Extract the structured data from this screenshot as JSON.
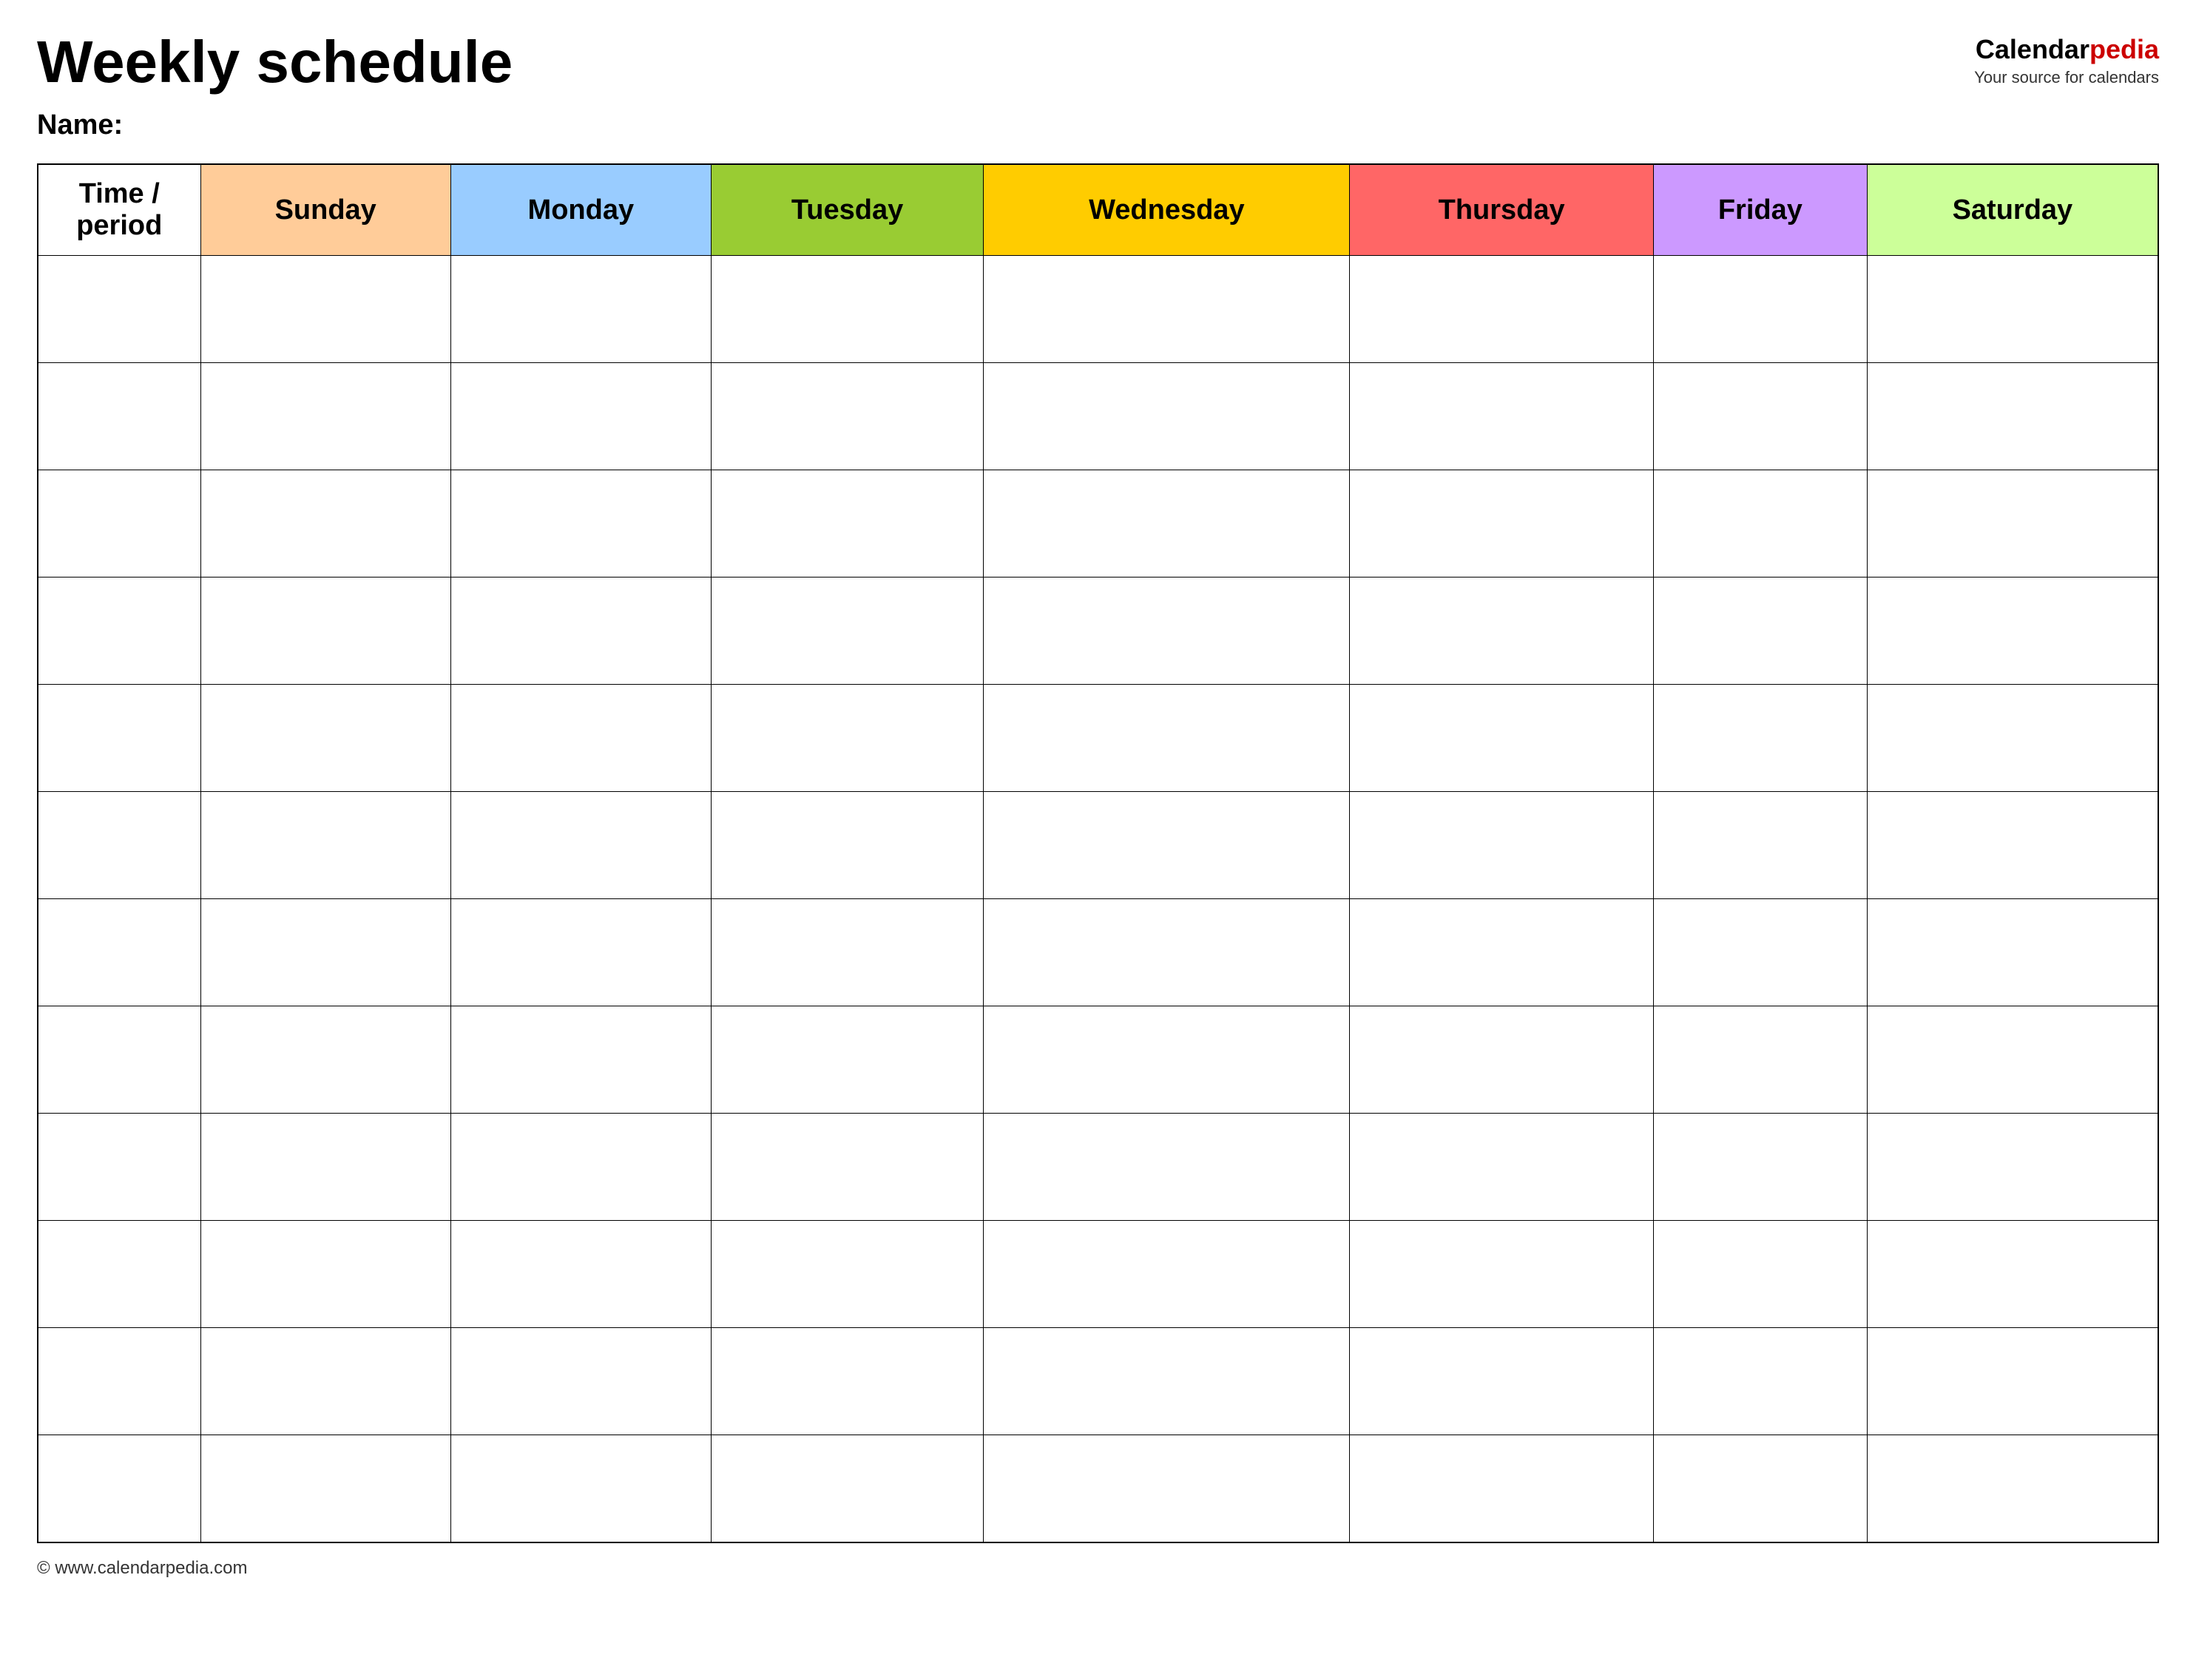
{
  "header": {
    "title": "Weekly schedule",
    "name_label": "Name:",
    "logo": {
      "brand_part1": "Calendar",
      "brand_part2": "pedia",
      "tagline": "Your source for calendars"
    }
  },
  "table": {
    "columns": [
      {
        "id": "time",
        "label": "Time / period",
        "color": "#ffffff",
        "class": "th-time"
      },
      {
        "id": "sunday",
        "label": "Sunday",
        "color": "#ffcc99",
        "class": "th-sunday"
      },
      {
        "id": "monday",
        "label": "Monday",
        "color": "#99ccff",
        "class": "th-monday"
      },
      {
        "id": "tuesday",
        "label": "Tuesday",
        "color": "#99cc33",
        "class": "th-tuesday"
      },
      {
        "id": "wednesday",
        "label": "Wednesday",
        "color": "#ffcc00",
        "class": "th-wednesday"
      },
      {
        "id": "thursday",
        "label": "Thursday",
        "color": "#ff6666",
        "class": "th-thursday"
      },
      {
        "id": "friday",
        "label": "Friday",
        "color": "#cc99ff",
        "class": "th-friday"
      },
      {
        "id": "saturday",
        "label": "Saturday",
        "color": "#ccff99",
        "class": "th-saturday"
      }
    ],
    "row_count": 12
  },
  "footer": {
    "url": "© www.calendarpedia.com"
  }
}
